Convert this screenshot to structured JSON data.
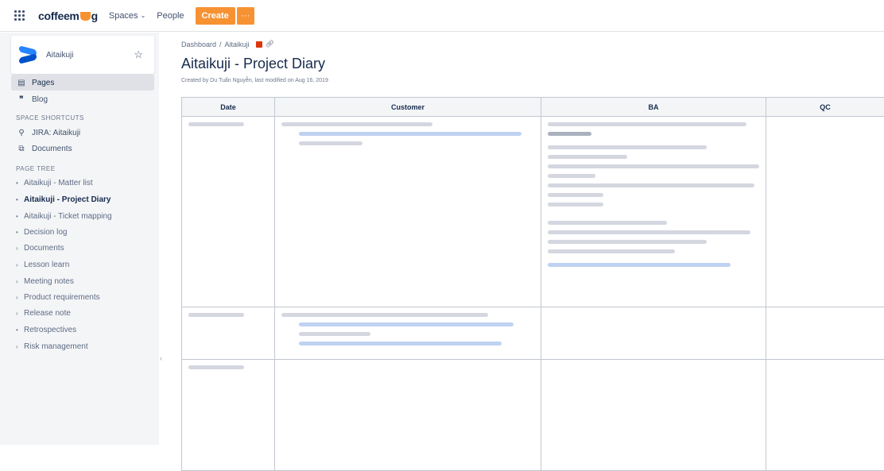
{
  "topbar": {
    "logo_text_1": "coffeem",
    "logo_text_2": "g",
    "spaces_label": "Spaces",
    "people_label": "People",
    "create_label": "Create",
    "more_label": "···"
  },
  "sidebar": {
    "space_name": "Aitaikuji",
    "pages_label": "Pages",
    "blog_label": "Blog",
    "shortcuts_title": "SPACE SHORTCUTS",
    "shortcuts": [
      {
        "label": "JIRA: Aitaikuji"
      },
      {
        "label": "Documents"
      }
    ],
    "tree_title": "PAGE TREE",
    "tree": [
      {
        "label": "Aitaikuji - Matter list",
        "bullet": "•"
      },
      {
        "label": "Aitaikuji - Project Diary",
        "bullet": "•"
      },
      {
        "label": "Aitaikuji - Ticket mapping",
        "bullet": "•"
      },
      {
        "label": "Decision log",
        "bullet": "•"
      },
      {
        "label": "Documents",
        "bullet": "›"
      },
      {
        "label": "Lesson learn",
        "bullet": "›"
      },
      {
        "label": "Meeting notes",
        "bullet": "›"
      },
      {
        "label": "Product requirements",
        "bullet": "›"
      },
      {
        "label": "Release note",
        "bullet": "›"
      },
      {
        "label": "Retrospectives",
        "bullet": "•"
      },
      {
        "label": "Risk management",
        "bullet": "›"
      }
    ]
  },
  "page": {
    "crumb_1": "Dashboard",
    "crumb_sep": "/",
    "crumb_2": "Aitaikuji",
    "title": "Aitaikuji - Project Diary",
    "byline": "Created by Du Tuấn Nguyễn, last modified on Aug 16, 2019"
  },
  "table": {
    "headers": [
      "Date",
      "Customer",
      "BA",
      "QC"
    ]
  },
  "colors": {
    "accent": "#f79232",
    "brand_blue": "#0052cc",
    "sidebar_bg": "#f4f5f7"
  }
}
